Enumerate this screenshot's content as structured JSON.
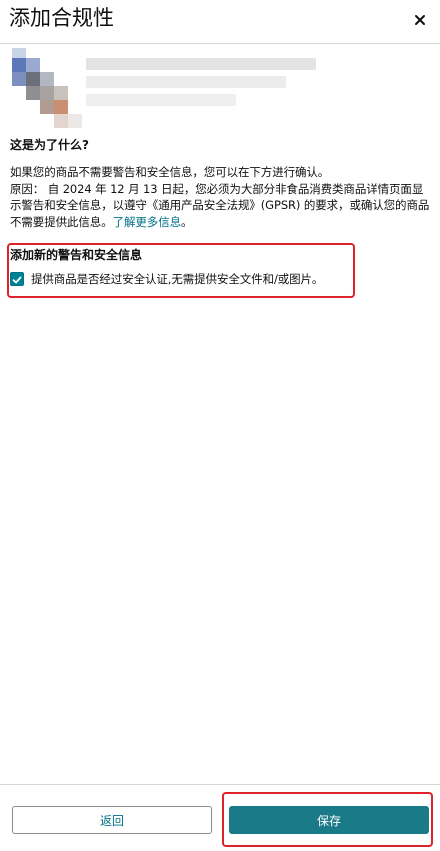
{
  "header": {
    "title": "添加合规性",
    "close_icon": "close-icon"
  },
  "product": {
    "image_icon": "product-thumbnail"
  },
  "question": {
    "heading": "这是为了什么?"
  },
  "explanation": {
    "line1": "如果您的商品不需要警告和安全信息，您可以在下方进行确认。",
    "reason": "原因： 自 2024 年 12 月 13 日起，您必须为大部分非食品消费类商品详情页面显示警告和安全信息，以遵守《通用产品安全法规》(GPSR) 的要求，或确认您的商品不需要提供此信息。",
    "learn_more": "了解更多信息",
    "period": "。"
  },
  "warnings": {
    "heading": "添加新的警告和安全信息",
    "checkbox_label": "提供商品是否经过安全认证,无需提供安全文件和/或图片。",
    "checkbox_checked": true
  },
  "footer": {
    "back_label": "返回",
    "save_label": "保存"
  },
  "colors": {
    "accent": "#1b7a87",
    "link": "#007185",
    "highlight": "#e0222a"
  }
}
